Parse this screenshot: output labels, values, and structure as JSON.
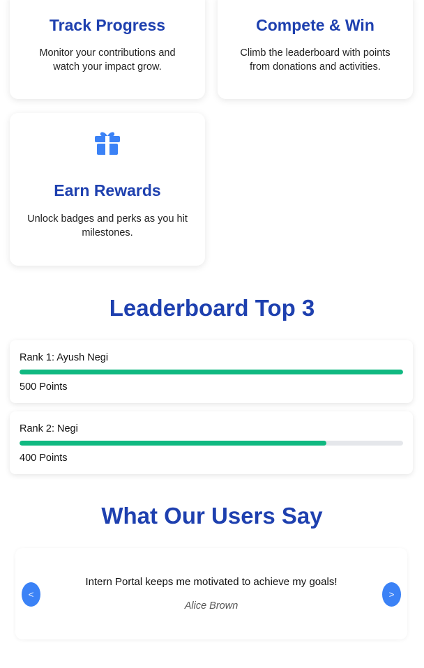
{
  "features": [
    {
      "title": "Track Progress",
      "description": "Monitor your contributions and watch your impact grow."
    },
    {
      "title": "Compete & Win",
      "description": "Climb the leaderboard with points from donations and activities."
    },
    {
      "title": "Earn Rewards",
      "description": "Unlock badges and perks as you hit milestones.",
      "icon": "gift-icon"
    }
  ],
  "leaderboard": {
    "title": "Leaderboard Top 3",
    "entries": [
      {
        "label": "Rank 1: Ayush Negi",
        "points_label": "500 Points",
        "progress": 1.0
      },
      {
        "label": "Rank 2: Negi",
        "points_label": "400 Points",
        "progress": 0.8
      }
    ]
  },
  "testimonials": {
    "title": "What Our Users Say",
    "quote": "Intern Portal keeps me motivated to achieve my goals!",
    "author": "Alice Brown",
    "prev_label": "<",
    "next_label": ">"
  },
  "colors": {
    "accent": "#1e40af",
    "button": "#3b82f6",
    "progress": "#10b981",
    "track": "#e5e7eb"
  }
}
